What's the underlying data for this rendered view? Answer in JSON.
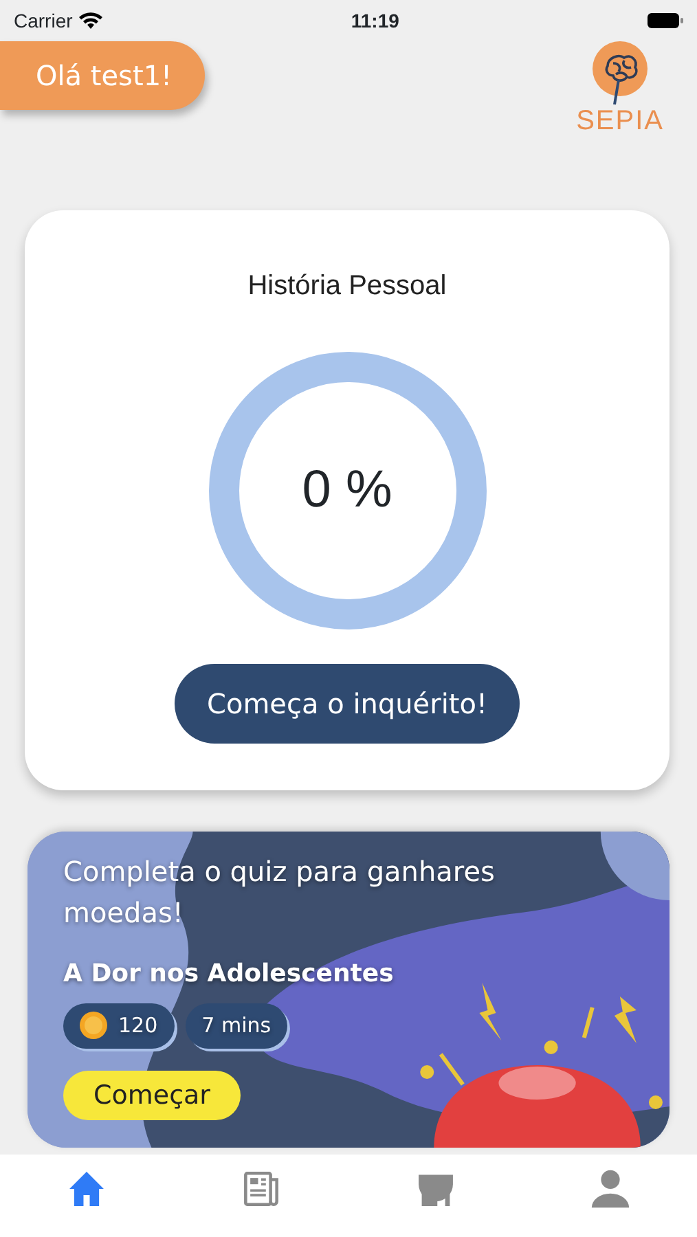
{
  "status_bar": {
    "carrier": "Carrier",
    "time": "11:19"
  },
  "header": {
    "greeting": "Olá test1!",
    "logo_text": "SEPIA"
  },
  "progress_card": {
    "title": "História Pessoal",
    "reading": "0 %",
    "button": "Começa o inquérito!"
  },
  "quiz_card": {
    "prompt": "Completa o quiz para ganhares moedas!",
    "quiz_title": "A Dor nos Adolescentes",
    "coins": "120",
    "duration": "7 mins",
    "button": "Começar",
    "kind": "picture"
  },
  "tab_bar": [
    {
      "kind": "home",
      "selected": true
    },
    {
      "kind": "news",
      "selected": false
    },
    {
      "kind": "store",
      "selected": false
    },
    {
      "kind": "profile",
      "selected": false
    }
  ]
}
